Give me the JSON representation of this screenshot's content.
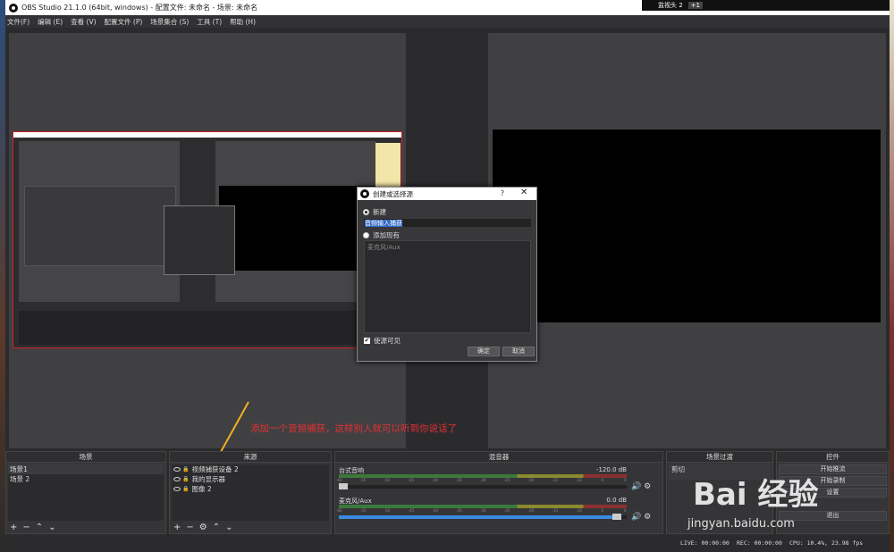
{
  "window": {
    "title": "OBS Studio 21.1.0 (64bit, windows) - 配置文件: 未命名 - 场景: 未命名",
    "notification": "监视头 2",
    "notification_tag": "+1"
  },
  "menu": [
    "文件(F)",
    "编辑 (E)",
    "查看 (V)",
    "配置文件 (P)",
    "场景集合 (S)",
    "工具 (T)",
    "帮助 (H)"
  ],
  "dialog": {
    "title": "创建或选择源",
    "help": "?",
    "close": "✕",
    "new_label": "新建",
    "name_value": "音频输入捕获",
    "existing_label": "添加现有",
    "existing_items": [
      "麦克风/Aux"
    ],
    "visible_label": "使源可见",
    "ok_label": "确定",
    "cancel_label": "取消"
  },
  "annotation": "添加一个音频捕获，这样别人就可以听到你说话了",
  "scenes": {
    "header": "场景",
    "items": [
      "场景1",
      "场景 2"
    ]
  },
  "sources": {
    "header": "来源",
    "items": [
      "视频捕获设备 2",
      "我的显示器",
      "图像 2"
    ]
  },
  "mixer": {
    "header": "混音器",
    "channels": [
      {
        "name": "台式音响",
        "db": "-120.0 dB",
        "volume": 0.03
      },
      {
        "name": "麦克风/Aux",
        "db": "0.0 dB",
        "volume": 0.98
      }
    ],
    "scale": [
      "-60",
      "-55",
      "-50",
      "-45",
      "-40",
      "-35",
      "-30",
      "-25",
      "-20",
      "-15",
      "-10",
      "-5",
      "0"
    ]
  },
  "transitions": {
    "header": "场景过渡",
    "selected": "剪切"
  },
  "controls": {
    "header": "控件",
    "start_stream": "开始推流",
    "start_record": "开始录制",
    "studio_mode": "设置",
    "exit": "退出"
  },
  "status": {
    "live": "LIVE: 00:00:00",
    "rec": "REC: 00:00:00",
    "cpu": "CPU: 10.4%, 23.98 fps"
  },
  "watermark": {
    "brand": "Bai 经验",
    "url": "jingyan.baidu.com"
  },
  "colors": {
    "annotation": "#e53030",
    "arrow": "#f0b020",
    "meter_green": "#3a7a3a",
    "slider_blue": "#3a8ae0"
  }
}
